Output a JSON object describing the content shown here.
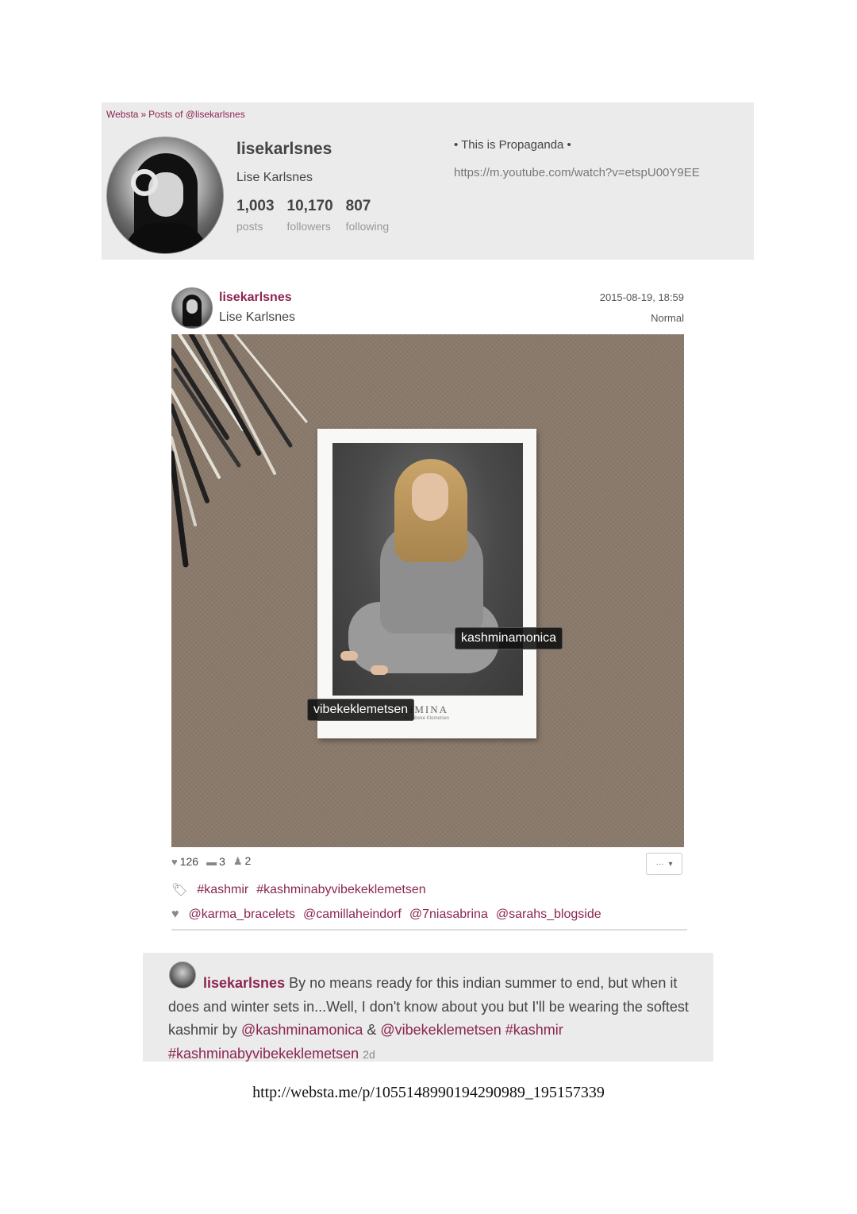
{
  "breadcrumb": {
    "site": "Websta",
    "separator": "»",
    "page": "Posts of @lisekarlsnes"
  },
  "profile": {
    "username": "lisekarlsnes",
    "full_name": "Lise Karlsnes",
    "stats": [
      {
        "value": "1,003",
        "label": "posts"
      },
      {
        "value": "10,170",
        "label": "followers"
      },
      {
        "value": "807",
        "label": "following"
      }
    ],
    "bio": "• This is Propaganda •",
    "website": "https://m.youtube.com/watch?v=etspU00Y9EE"
  },
  "post": {
    "username": "lisekarlsnes",
    "full_name": "Lise Karlsnes",
    "date": "2015-08-19, 18:59",
    "filter": "Normal",
    "image": {
      "brand_text": "HMINA",
      "brand_sub": "by Vibeke Klemetsen",
      "user_tags": [
        "kashminamonica",
        "vibekeklemetsen"
      ]
    },
    "counts": {
      "likes": "126",
      "comments": "3",
      "tagged": "2"
    },
    "more_button": "···",
    "hashtags": [
      "#kashmir",
      "#kashminabyvibekeklemetsen"
    ],
    "liked_by": [
      "@karma_bracelets",
      "@camillaheindorf",
      "@7niasabrina",
      "@sarahs_blogside"
    ]
  },
  "caption": {
    "username": "lisekarlsnes",
    "text_1": " By no means ready for this indian summer to end, but when it does and winter sets in...Well, I don't know about you but I'll be wearing the softest kashmir by ",
    "mention_1": "@kashminamonica",
    "amp": " & ",
    "mention_2": "@vibekeklemetsen",
    "hashtags": "#kashmir #kashminabyvibekeklemetsen",
    "age": "2d"
  },
  "source_url": "http://websta.me/p/1055148990194290989_195157339",
  "colors": {
    "accent": "#8b2550",
    "panel": "#ebebeb"
  },
  "icons": {
    "likes": "heart-icon",
    "comments": "comment-icon",
    "tagged": "person-icon",
    "tags": "tag-icon",
    "liked": "heart-icon",
    "more": "chevron-down-icon"
  }
}
